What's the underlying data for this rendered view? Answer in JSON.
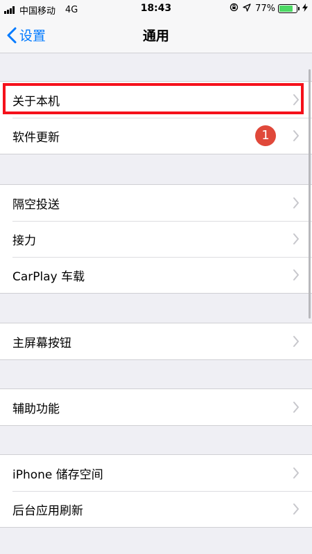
{
  "status": {
    "carrier": "中国移动",
    "network": "4G",
    "time": "18:43",
    "battery_percent": "77%",
    "battery_level": 0.77,
    "icons": [
      "signal-bars",
      "orientation-lock-icon",
      "location-arrow-icon",
      "battery-icon",
      "charging-bolt-icon"
    ]
  },
  "nav": {
    "back_label": "设置",
    "title": "通用"
  },
  "groups": [
    {
      "rows": [
        {
          "label": "关于本机",
          "highlighted": true
        },
        {
          "label": "软件更新",
          "badge": "1"
        }
      ]
    },
    {
      "rows": [
        {
          "label": "隔空投送"
        },
        {
          "label": "接力"
        },
        {
          "label": "CarPlay 车载"
        }
      ]
    },
    {
      "rows": [
        {
          "label": "主屏幕按钮"
        }
      ]
    },
    {
      "rows": [
        {
          "label": "辅助功能"
        }
      ]
    },
    {
      "rows": [
        {
          "label": "iPhone 储存空间"
        },
        {
          "label": "后台应用刷新"
        }
      ]
    }
  ],
  "colors": {
    "accent": "#007aff",
    "badge": "#e0483a",
    "highlight": "#f5111b",
    "background": "#efeff4"
  }
}
